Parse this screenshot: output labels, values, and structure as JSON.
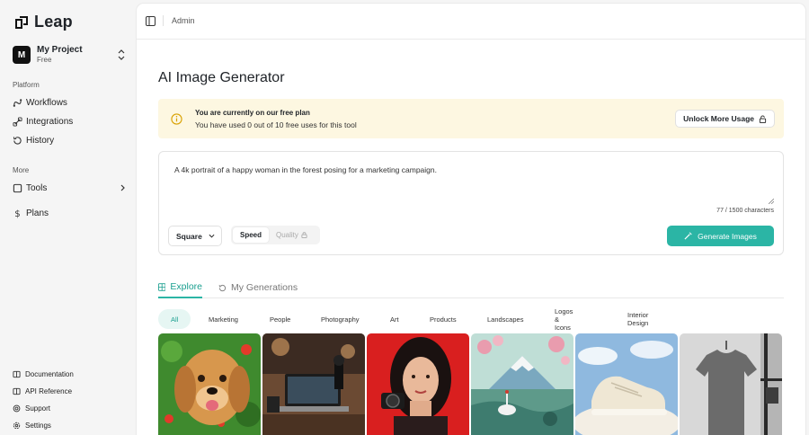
{
  "brand": {
    "name": "Leap"
  },
  "project": {
    "initial": "M",
    "name": "My Project",
    "plan": "Free"
  },
  "sidebar": {
    "platform_label": "Platform",
    "platform_items": [
      {
        "label": "Workflows",
        "icon": "workflow-icon"
      },
      {
        "label": "Integrations",
        "icon": "integrations-icon"
      },
      {
        "label": "History",
        "icon": "history-icon"
      }
    ],
    "more_label": "More",
    "more_items": [
      {
        "label": "Tools",
        "icon": "tools-icon"
      },
      {
        "label": "Plans",
        "icon": "dollar-icon"
      }
    ],
    "footer_items": [
      {
        "label": "Documentation",
        "icon": "book-icon"
      },
      {
        "label": "API Reference",
        "icon": "book-icon"
      },
      {
        "label": "Support",
        "icon": "support-icon"
      },
      {
        "label": "Settings",
        "icon": "gear-icon"
      }
    ]
  },
  "header": {
    "breadcrumb": "Admin"
  },
  "page": {
    "title": "AI Image Generator"
  },
  "notice": {
    "title": "You are currently on our free plan",
    "message": "You have used 0 out of 10 free uses for this tool",
    "button": "Unlock More Usage"
  },
  "composer": {
    "prompt": "A 4k portrait of a happy woman in the forest posing for a marketing campaign.",
    "char_count": "77 / 1500 characters",
    "size": "Square",
    "mode_speed": "Speed",
    "mode_quality": "Quality",
    "generate": "Generate Images"
  },
  "tabs": {
    "explore": "Explore",
    "my_generations": "My Generations"
  },
  "filters": [
    "All",
    "Marketing",
    "People",
    "Photography",
    "Art",
    "Products",
    "Landscapes",
    "Logos & Icons",
    "Interior Design"
  ],
  "colors": {
    "accent": "#2bb5a5",
    "notice_bg": "#fdf7e1"
  }
}
